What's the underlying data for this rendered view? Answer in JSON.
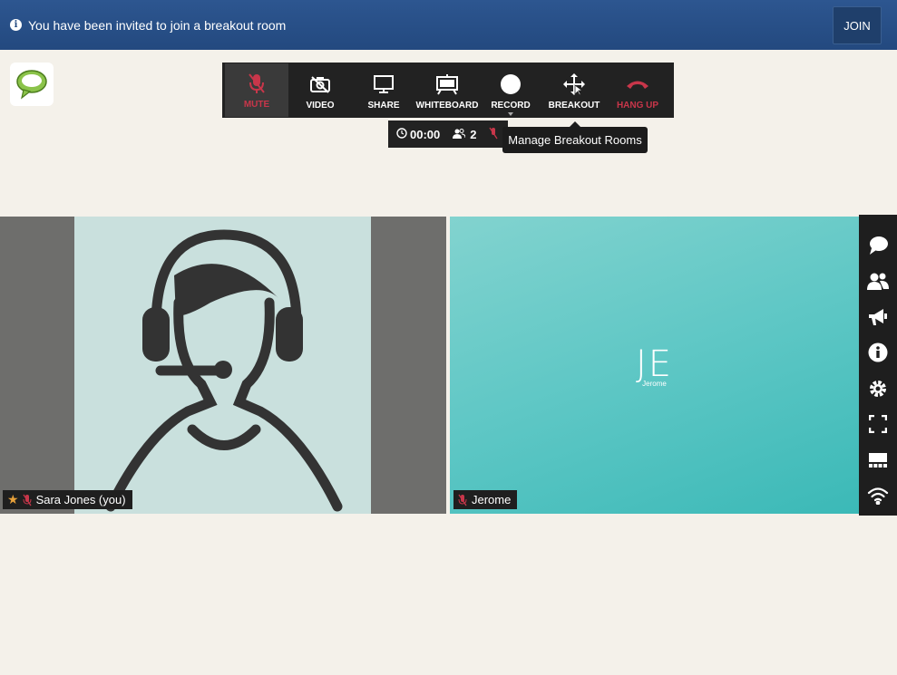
{
  "banner": {
    "message": "You have been invited to join a breakout room",
    "join_label": "JOIN",
    "color": "#2a5189"
  },
  "toolbar": {
    "tools": [
      {
        "label": "MUTE",
        "icon": "mic-muted-icon",
        "state": "active",
        "color": "#c8364a"
      },
      {
        "label": "VIDEO",
        "icon": "camera-off-icon"
      },
      {
        "label": "SHARE",
        "icon": "monitor-icon"
      },
      {
        "label": "WHITEBOARD",
        "icon": "whiteboard-icon"
      },
      {
        "label": "RECORD",
        "icon": "record-circle-icon"
      },
      {
        "label": "BREAKOUT",
        "icon": "move-arrows-icon"
      },
      {
        "label": "HANG UP",
        "icon": "phone-hangup-icon",
        "color": "#c8364a"
      }
    ]
  },
  "status": {
    "timer": "00:00",
    "participant_count": "2"
  },
  "tooltip": {
    "text": "Manage Breakout Rooms"
  },
  "participants": [
    {
      "name": "Sara Jones (you)",
      "muted": true,
      "host": true,
      "avatar": "headset-person-icon"
    },
    {
      "name": "Jerome",
      "initials": "JE",
      "caption": "Jerome",
      "muted": true,
      "tile_color": "#5ec7c5"
    }
  ],
  "side_rail": {
    "icons": [
      "chat-icon",
      "people-icon",
      "megaphone-icon",
      "info-icon",
      "gear-icon",
      "fullscreen-icon",
      "layout-icon",
      "wifi-icon"
    ]
  }
}
